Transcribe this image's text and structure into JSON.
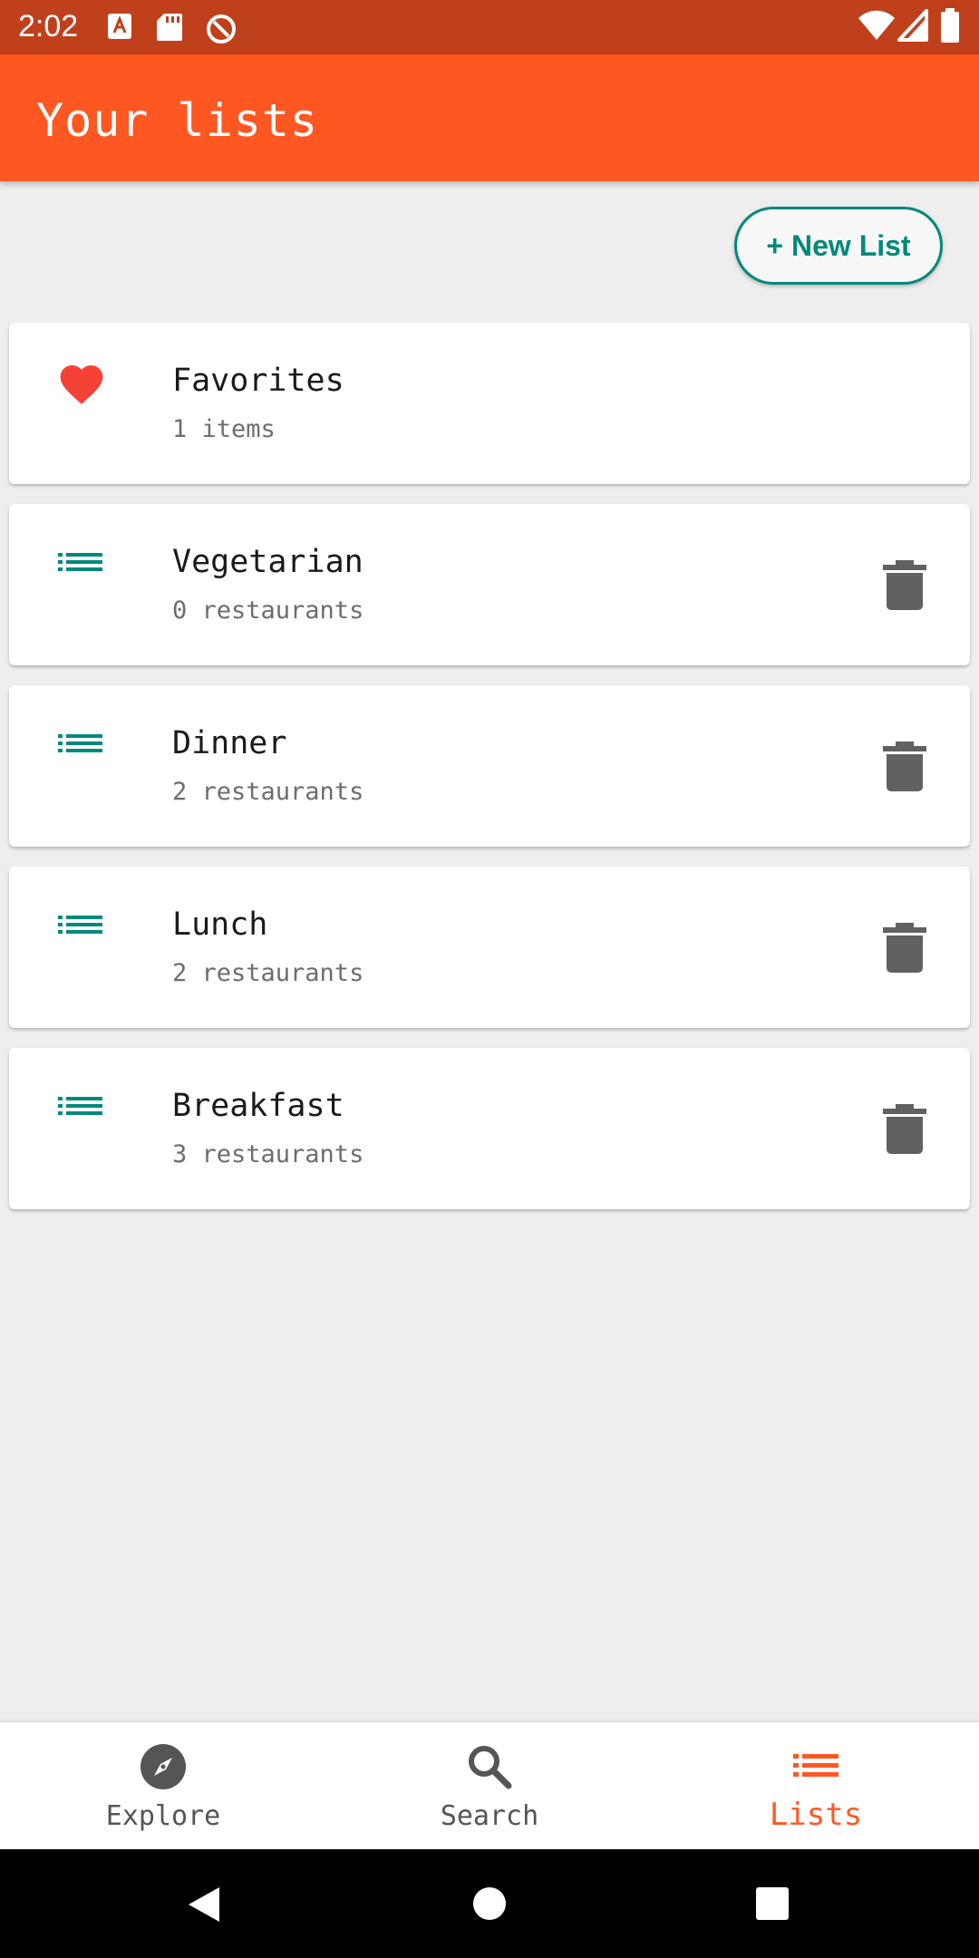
{
  "status_bar": {
    "time": "2:02",
    "left_icons": [
      "a-notification-icon",
      "sd-card-icon",
      "block-icon"
    ],
    "right_icons": [
      "wifi-icon",
      "signal-icon",
      "battery-icon"
    ]
  },
  "app_bar": {
    "title": "Your lists"
  },
  "new_list_button": {
    "label": "+ New List"
  },
  "lists": [
    {
      "title": "Favorites",
      "subtitle": "1 items",
      "icon": "heart-icon",
      "deletable": false
    },
    {
      "title": "Vegetarian",
      "subtitle": "0 restaurants",
      "icon": "list-icon",
      "deletable": true
    },
    {
      "title": "Dinner",
      "subtitle": "2 restaurants",
      "icon": "list-icon",
      "deletable": true
    },
    {
      "title": "Lunch",
      "subtitle": "2 restaurants",
      "icon": "list-icon",
      "deletable": true
    },
    {
      "title": "Breakfast",
      "subtitle": "3 restaurants",
      "icon": "list-icon",
      "deletable": true
    }
  ],
  "bottom_nav": [
    {
      "label": "Explore",
      "icon": "compass-icon",
      "active": false
    },
    {
      "label": "Search",
      "icon": "search-icon",
      "active": false
    },
    {
      "label": "Lists",
      "icon": "list-icon",
      "active": true
    }
  ],
  "colors": {
    "status_bar": "#bf401b",
    "app_bar": "#ff5722",
    "accent_teal": "#00897b",
    "heart_red": "#f44336",
    "active_nav": "#ff5722",
    "background": "#eeeeee"
  }
}
